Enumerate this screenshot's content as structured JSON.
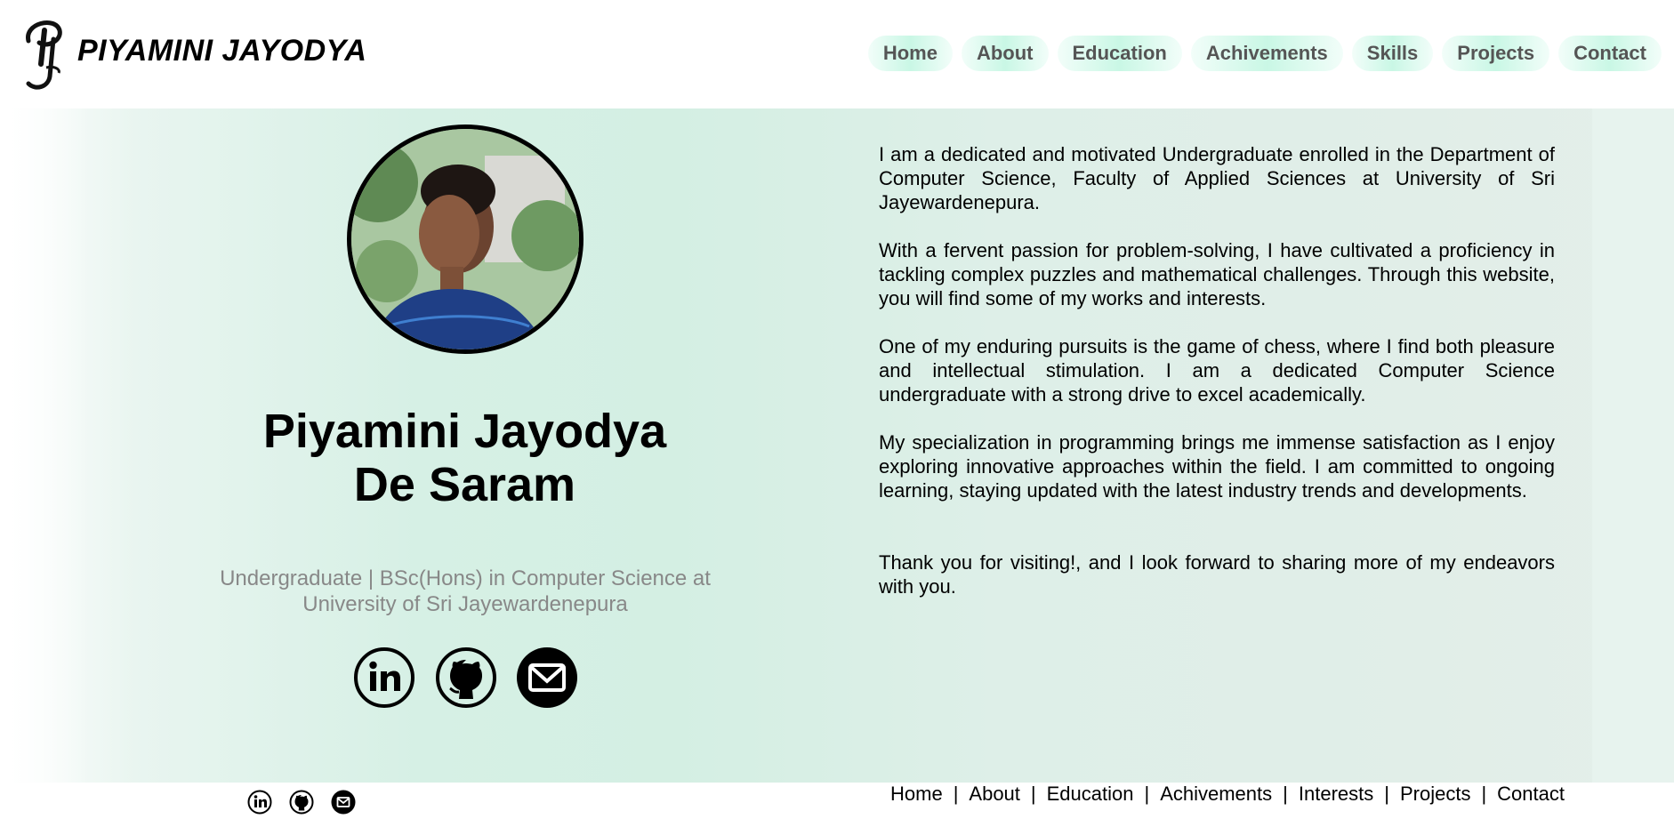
{
  "brand": {
    "logo_text": "PIYAMINI JAYODYA",
    "logo_mark": "PJ-monogram"
  },
  "nav": [
    "Home",
    "About",
    "Education",
    "Achivements",
    "Skills",
    "Projects",
    "Contact"
  ],
  "profile": {
    "name_line1": "Piyamini Jayodya",
    "name_line2": "De Saram",
    "subtitle_line1": "Undergraduate | BSc(Hons) in Computer Science at",
    "subtitle_line2": "University of Sri Jayewardenepura",
    "photo_icon": "profile-photo"
  },
  "social": [
    {
      "icon": "linkedin-icon"
    },
    {
      "icon": "github-icon"
    },
    {
      "icon": "email-icon"
    }
  ],
  "about": [
    "I am a dedicated and motivated Undergraduate enrolled in the Department of Computer Science, Faculty of Applied Sciences at University of Sri Jayewardenepura.",
    "With a fervent passion for problem-solving, I have cultivated a proficiency in tackling complex puzzles and mathematical challenges. Through this website, you will find some of my works and interests.",
    "One of my enduring pursuits is the game of chess, where I find both pleasure and intellectual stimulation. I am a dedicated Computer Science undergraduate with a strong drive to excel academically.",
    "My specialization in programming brings me immense satisfaction as I enjoy exploring innovative approaches within the field. I am committed to ongoing learning, staying updated with the latest industry trends and developments.",
    "Thank you for visiting!, and I look forward to sharing more of my endeavors with you."
  ],
  "footer": {
    "links": [
      "Home",
      "About",
      "Education",
      "Achivements",
      "Interests",
      "Projects",
      "Contact"
    ],
    "separator": "|"
  },
  "colors": {
    "nav_pill": "#c9f7e5",
    "hero_bg": "#d6f0e5",
    "subtitle": "#888888",
    "nav_text": "#555555"
  }
}
